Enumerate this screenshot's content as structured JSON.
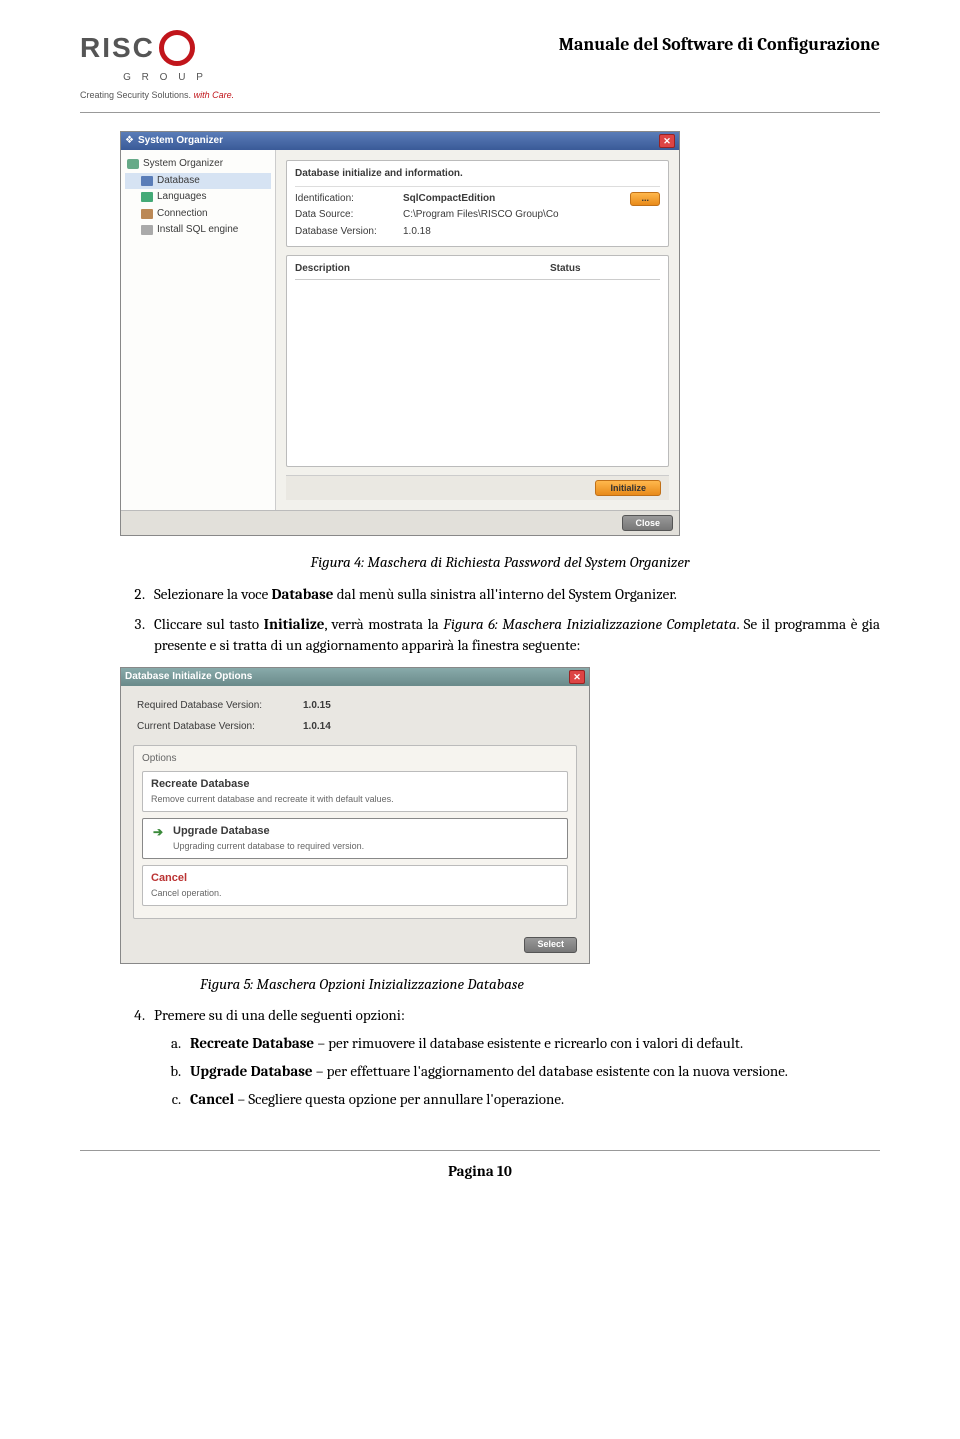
{
  "header": {
    "doc_title": "Manuale del Software di Configurazione",
    "logo_text": "RISC",
    "logo_group": "G R O U P",
    "logo_tagline": "Creating Security Solutions.",
    "logo_withcare": "with Care."
  },
  "shot1": {
    "title": "System Organizer",
    "tree": {
      "root": "System Organizer",
      "database": "Database",
      "languages": "Languages",
      "connection": "Connection",
      "install_sql": "Install SQL engine"
    },
    "info_head": "Database initialize and information.",
    "identification_k": "Identification:",
    "identification_v": "SqlCompactEdition",
    "data_source_k": "Data Source:",
    "data_source_v": "C:\\Program Files\\RISCO Group\\Co",
    "db_version_k": "Database Version:",
    "db_version_v": "1.0.18",
    "col_desc": "Description",
    "col_status": "Status",
    "btn_dots": "...",
    "btn_initialize": "Initialize",
    "btn_close": "Close"
  },
  "caption1": "Figura 4: Maschera di Richiesta Password del System Organizer",
  "step2_a": "Selezionare la voce ",
  "step2_b": "Database",
  "step2_c": " dal menù sulla sinistra all'interno del System Organizer.",
  "step3_a": " Cliccare sul tasto ",
  "step3_b": "Initialize",
  "step3_c": ", verrà mostrata la ",
  "step3_d": "Figura 6: Maschera Inizializzazione Completata",
  "step3_e": ". Se il programma è gia presente e si tratta di un aggiornamento apparirà la finestra seguente:",
  "shot2": {
    "title": "Database Initialize Options",
    "req_k": "Required Database Version:",
    "req_v": "1.0.15",
    "cur_k": "Current Database Version:",
    "cur_v": "1.0.14",
    "options_head": "Options",
    "opt1_t": "Recreate Database",
    "opt1_d": "Remove current database and recreate it with default values.",
    "opt2_t": "Upgrade Database",
    "opt2_d": "Upgrading current database to required version.",
    "opt3_t": "Cancel",
    "opt3_d": "Cancel operation.",
    "btn_select": "Select"
  },
  "caption2": "Figura 5: Maschera Opzioni Inizializzazione Database",
  "step4": "Premere su di una delle seguenti opzioni:",
  "step4a_b": "Recreate Database",
  "step4a_t": " – per rimuovere il database esistente e ricrearlo con i valori di default.",
  "step4b_b": "Upgrade Database",
  "step4b_t": " – per effettuare l'aggiornamento del database esistente con la nuova versione.",
  "step4c_b": "Cancel",
  "step4c_t": " – Scegliere questa opzione per annullare l'operazione.",
  "page_num": "Pagina 10"
}
